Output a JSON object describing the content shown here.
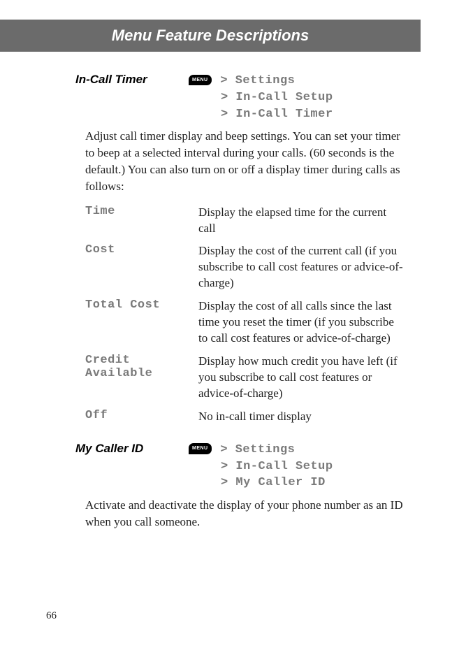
{
  "header": {
    "title": "Menu Feature Descriptions"
  },
  "features": [
    {
      "name": "In-Call Timer",
      "menu_button": "MENU",
      "path": [
        "Settings",
        "In-Call Setup",
        "In-Call Timer"
      ],
      "description": "Adjust call timer display and beep settings. You can set your timer to beep at a selected interval during your calls. (60 seconds is the default.) You can also turn on or off a display timer during calls as follows:",
      "options": [
        {
          "name": "Time",
          "desc": "Display the elapsed time for the current call"
        },
        {
          "name": "Cost",
          "desc": "Display the cost of the current call (if you subscribe to call cost features or advice-of-charge)"
        },
        {
          "name": "Total Cost",
          "desc": "Display the cost of all calls since the last time you reset the timer (if you subscribe to call cost features or advice-of-charge)"
        },
        {
          "name": "Credit Available",
          "desc": "Display how much credit you have left (if you subscribe to call cost features or advice-of-charge)"
        },
        {
          "name": "Off",
          "desc": "No in-call timer display"
        }
      ]
    },
    {
      "name": "My Caller ID",
      "menu_button": "MENU",
      "path": [
        "Settings",
        "In-Call Setup",
        "My Caller ID"
      ],
      "description": "Activate and deactivate the display of your phone number as an ID when you call someone."
    }
  ],
  "page_number": "66"
}
